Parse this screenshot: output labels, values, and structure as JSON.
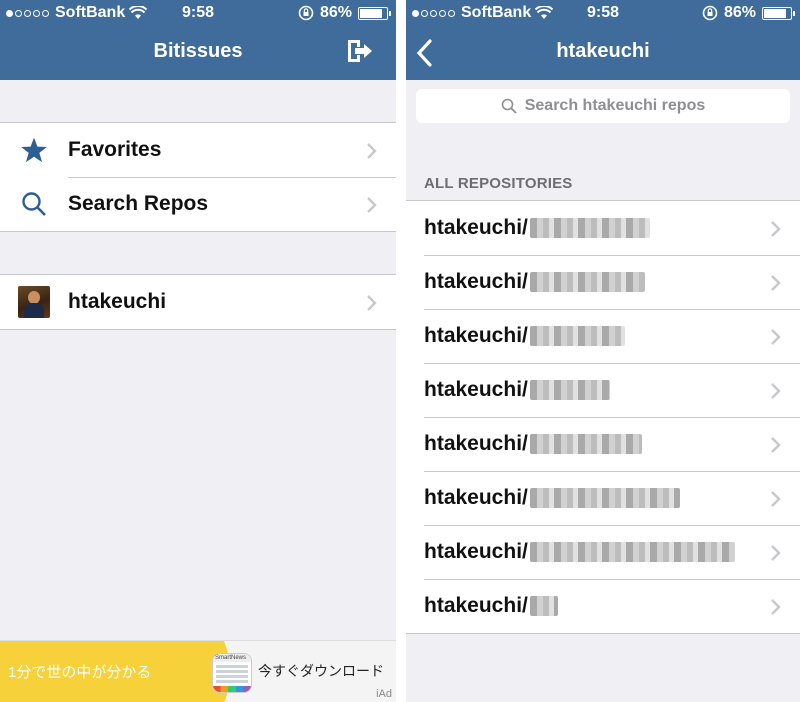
{
  "status_bar": {
    "carrier": "SoftBank",
    "time": "9:58",
    "battery_text": "86%",
    "battery_level": 0.86
  },
  "left_screen": {
    "title": "Bitissues",
    "menu": [
      {
        "label": "Favorites",
        "icon": "star-icon"
      },
      {
        "label": "Search Repos",
        "icon": "magnifier-icon"
      }
    ],
    "account": {
      "label": "htakeuchi",
      "icon": "avatar"
    },
    "ad": {
      "tagline": "1分で世の中が分かる",
      "app_name": "SmartNews",
      "cta": "今すぐダウンロード",
      "badge": "iAd"
    }
  },
  "right_screen": {
    "title": "htakeuchi",
    "search_placeholder": "Search htakeuchi repos",
    "section_header": "ALL REPOSITORIES",
    "repos": [
      {
        "prefix": "htakeuchi/",
        "redacted_width": 120
      },
      {
        "prefix": "htakeuchi/",
        "redacted_width": 115
      },
      {
        "prefix": "htakeuchi/",
        "redacted_width": 95
      },
      {
        "prefix": "htakeuchi/",
        "redacted_width": 80
      },
      {
        "prefix": "htakeuchi/",
        "redacted_width": 112
      },
      {
        "prefix": "htakeuchi/",
        "redacted_width": 150
      },
      {
        "prefix": "htakeuchi/",
        "redacted_width": 205
      },
      {
        "prefix": "htakeuchi/",
        "redacted_width": 28
      }
    ]
  },
  "colors": {
    "navbar": "#3f6c9b",
    "background": "#efeff4",
    "ad_yellow": "#f7d13a",
    "accent_blue": "#2d5f93"
  }
}
